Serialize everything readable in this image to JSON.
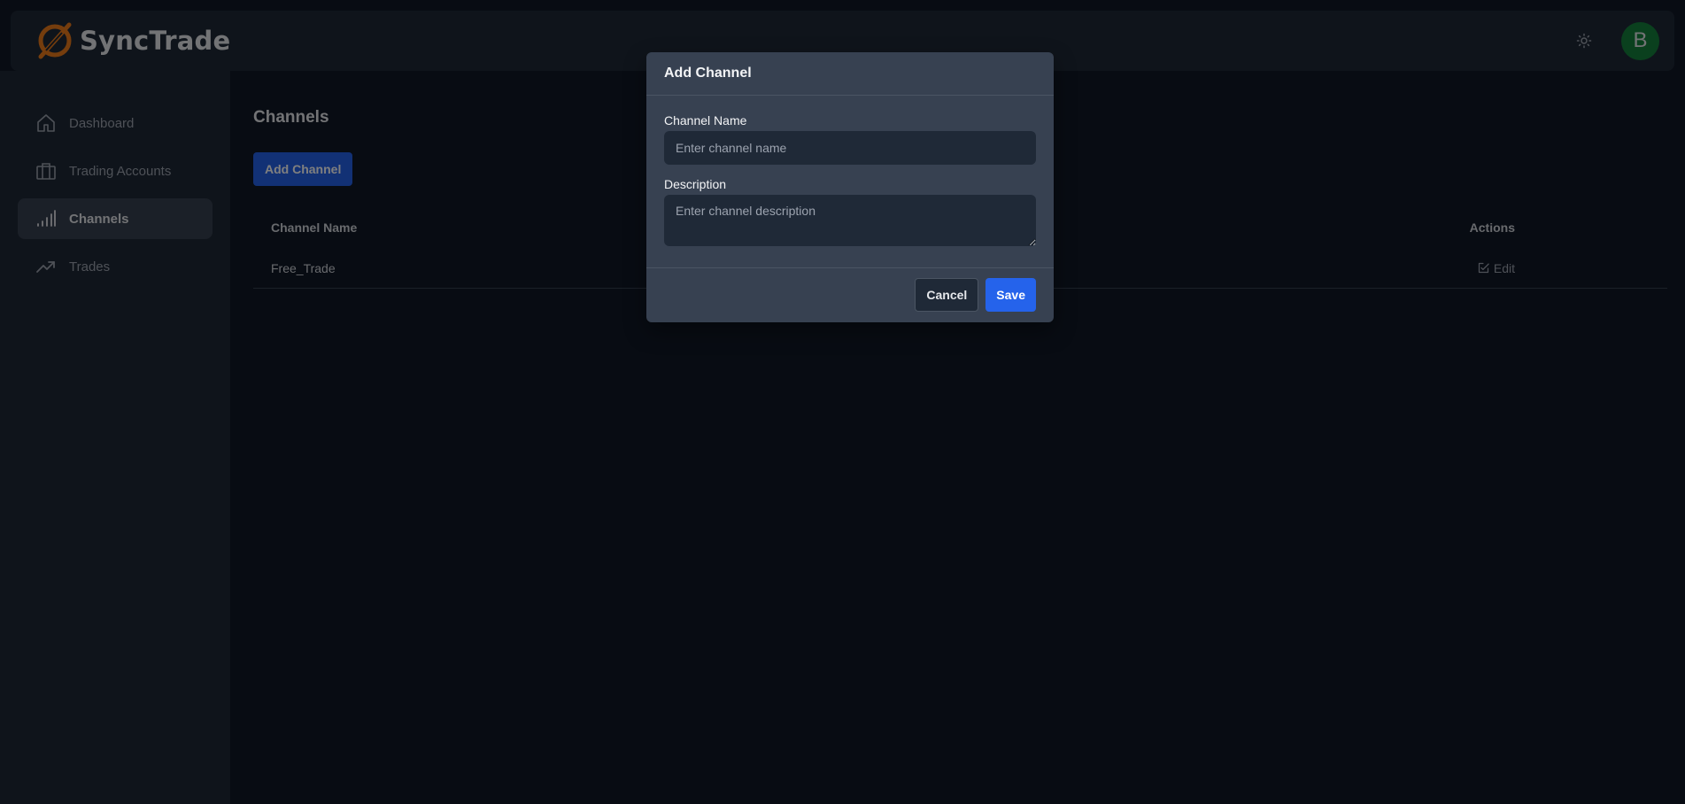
{
  "header": {
    "brand_name": "SyncTrade",
    "avatar_initial": "B",
    "theme_icon": "sun-icon"
  },
  "sidebar": {
    "items": [
      {
        "label": "Dashboard",
        "icon": "home-icon",
        "active": false
      },
      {
        "label": "Trading Accounts",
        "icon": "briefcase-icon",
        "active": false
      },
      {
        "label": "Channels",
        "icon": "signal-bars-icon",
        "active": true
      },
      {
        "label": "Trades",
        "icon": "trending-up-icon",
        "active": false
      }
    ]
  },
  "main": {
    "title": "Channels",
    "add_button_label": "Add Channel",
    "table": {
      "columns": [
        "Channel Name",
        "Actions"
      ],
      "rows": [
        {
          "channel_name": "Free_Trade",
          "action_label": "Edit"
        }
      ]
    }
  },
  "modal": {
    "title": "Add Channel",
    "name_label": "Channel Name",
    "name_placeholder": "Enter channel name",
    "name_value": "",
    "description_label": "Description",
    "description_placeholder": "Enter channel description",
    "description_value": "",
    "cancel_label": "Cancel",
    "save_label": "Save"
  },
  "colors": {
    "background": "#111827",
    "surface": "#1f2937",
    "modal": "#374151",
    "accent": "#2563eb",
    "brand_orange": "#ea7a1a",
    "avatar": "#15803d"
  }
}
